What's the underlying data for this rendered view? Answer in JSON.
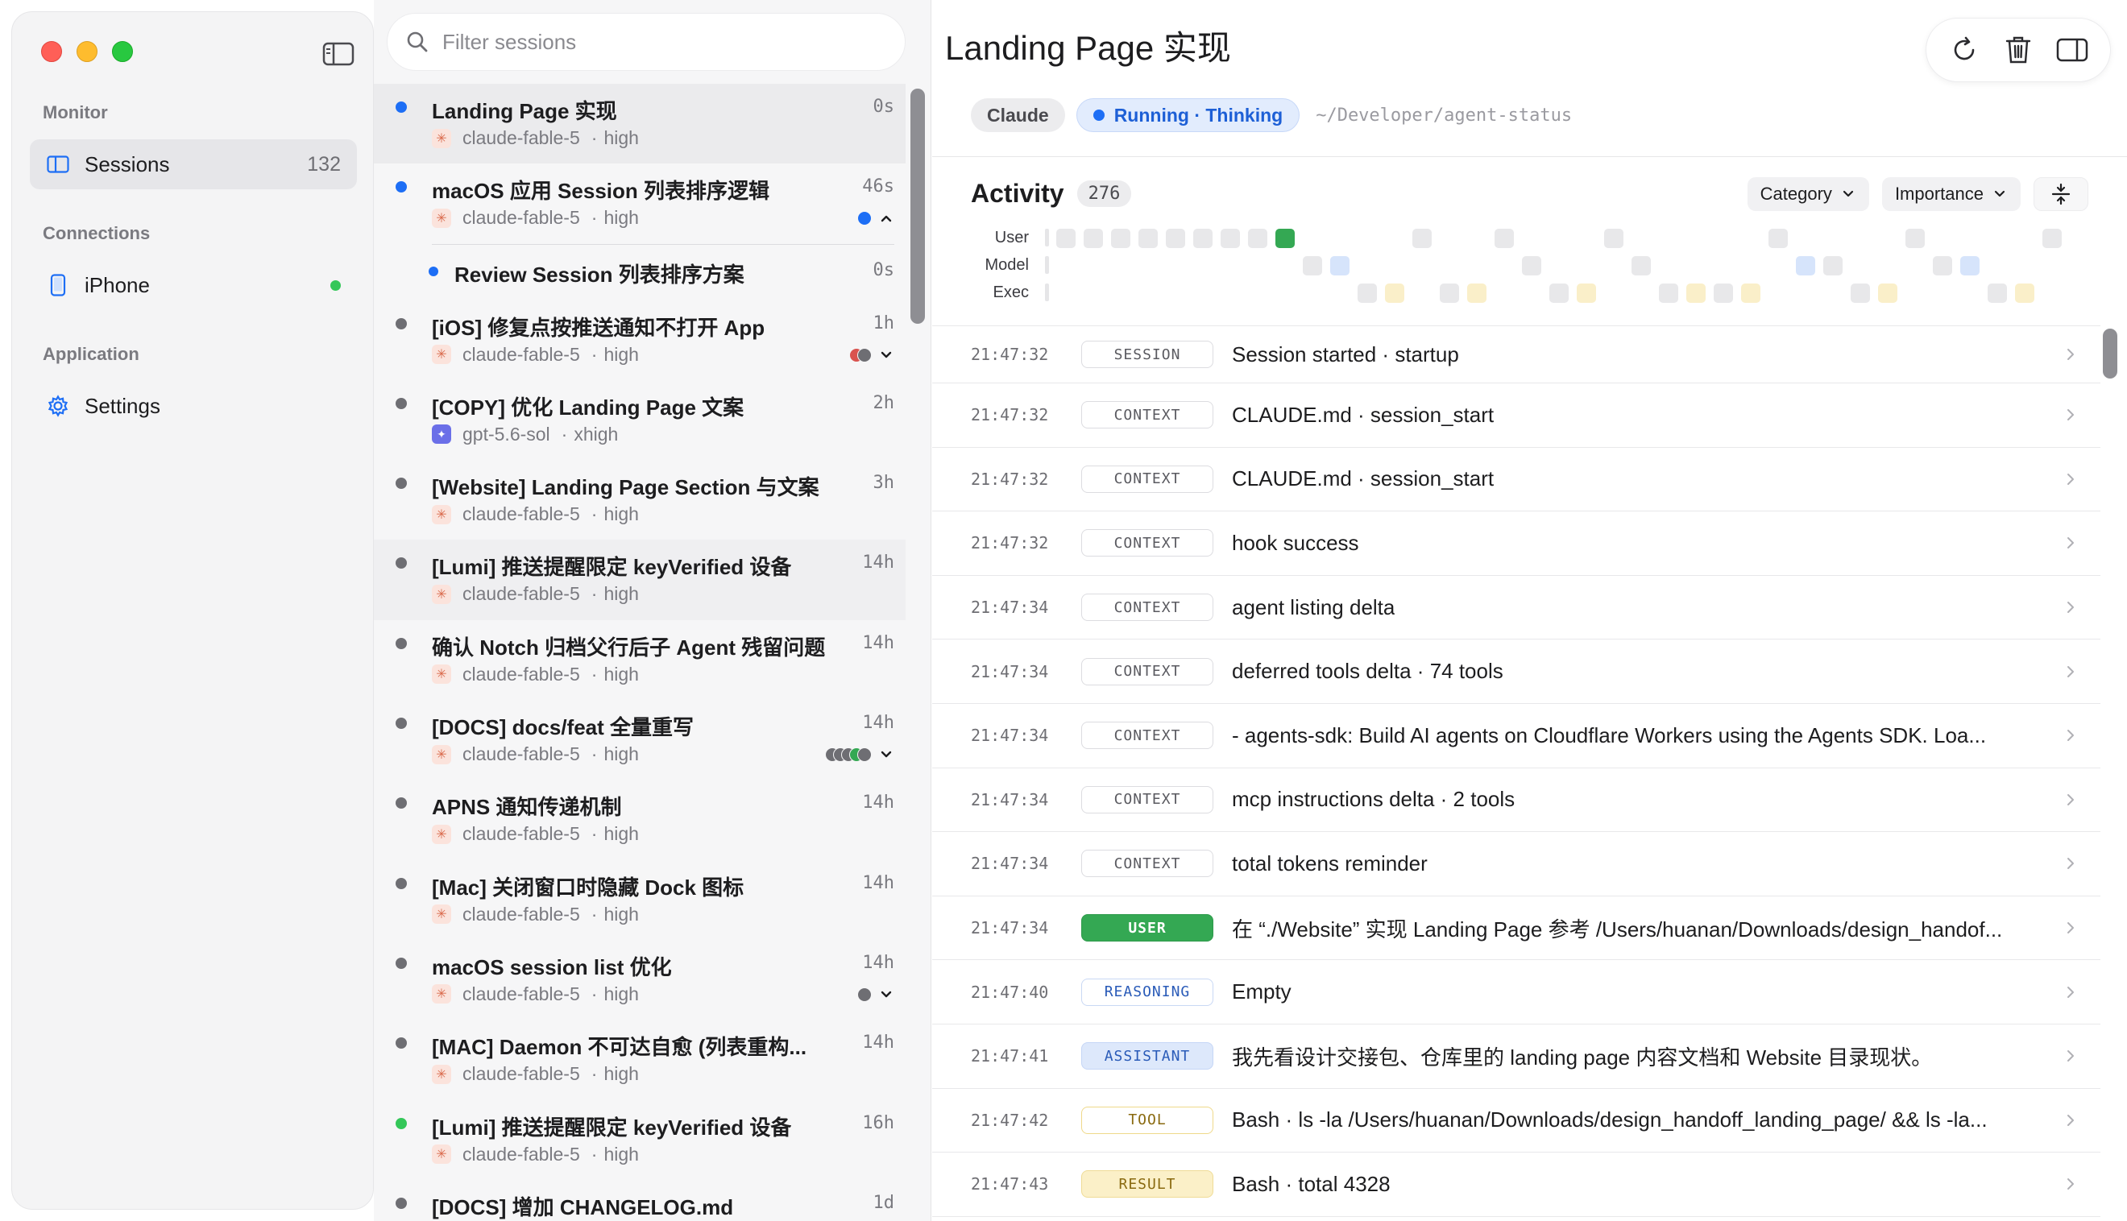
{
  "sidebar": {
    "sections": [
      {
        "label": "Monitor",
        "items": [
          {
            "label": "Sessions",
            "count": "132",
            "icon": "sidebar-panel-icon"
          }
        ]
      },
      {
        "label": "Connections",
        "items": [
          {
            "label": "iPhone",
            "icon": "phone-icon",
            "status": "online"
          }
        ]
      },
      {
        "label": "Application",
        "items": [
          {
            "label": "Settings",
            "icon": "gear-icon"
          }
        ]
      }
    ]
  },
  "search": {
    "placeholder": "Filter sessions"
  },
  "sessions": [
    {
      "title": "Landing Page 实现",
      "time": "0s",
      "model": "claude-fable-5",
      "effort": "high",
      "dot": "blue",
      "provider": "claude",
      "state": "selected"
    },
    {
      "title": "macOS 应用 Session 列表排序逻辑",
      "time": "46s",
      "model": "claude-fable-5",
      "effort": "high",
      "dot": "blue",
      "provider": "claude",
      "status_dots": [
        "#1d6ef5"
      ],
      "expanded": true,
      "children": [
        {
          "title": "Review Session 列表排序方案",
          "time": "0s"
        }
      ]
    },
    {
      "title": "[iOS] 修复点按推送通知不打开 App",
      "time": "1h",
      "model": "claude-fable-5",
      "effort": "high",
      "dot": "gray",
      "provider": "claude",
      "status_dots": [
        "#d9534f",
        "#6e6e73"
      ],
      "collapsed": true
    },
    {
      "title": "[COPY] 优化 Landing Page 文案",
      "time": "2h",
      "model": "gpt-5.6-sol",
      "effort": "xhigh",
      "dot": "gray",
      "provider": "gpt"
    },
    {
      "title": "[Website] Landing Page Section 与文案",
      "time": "3h",
      "model": "claude-fable-5",
      "effort": "high",
      "dot": "gray",
      "provider": "claude"
    },
    {
      "title": "[Lumi] 推送提醒限定 keyVerified 设备",
      "time": "14h",
      "model": "claude-fable-5",
      "effort": "high",
      "dot": "gray",
      "provider": "claude",
      "state": "hovered"
    },
    {
      "title": "确认 Notch 归档父行后子 Agent 残留问题",
      "time": "14h",
      "model": "claude-fable-5",
      "effort": "high",
      "dot": "gray",
      "provider": "claude"
    },
    {
      "title": "[DOCS] docs/feat 全量重写",
      "time": "14h",
      "model": "claude-fable-5",
      "effort": "high",
      "dot": "gray",
      "provider": "claude",
      "status_dots": [
        "#6e6e73",
        "#6e6e73",
        "#6e6e73",
        "#34a853",
        "#6e6e73"
      ],
      "collapsed": true
    },
    {
      "title": "APNS 通知传递机制",
      "time": "14h",
      "model": "claude-fable-5",
      "effort": "high",
      "dot": "gray",
      "provider": "claude"
    },
    {
      "title": "[Mac] 关闭窗口时隐藏 Dock 图标",
      "time": "14h",
      "model": "claude-fable-5",
      "effort": "high",
      "dot": "gray",
      "provider": "claude"
    },
    {
      "title": "macOS session list 优化",
      "time": "14h",
      "model": "claude-fable-5",
      "effort": "high",
      "dot": "gray",
      "provider": "claude",
      "status_dots": [
        "#6e6e73"
      ],
      "collapsed": true
    },
    {
      "title": "[MAC] Daemon 不可达自愈 (列表重构...",
      "time": "14h",
      "model": "claude-fable-5",
      "effort": "high",
      "dot": "gray",
      "provider": "claude"
    },
    {
      "title": "[Lumi] 推送提醒限定 keyVerified 设备",
      "time": "16h",
      "model": "claude-fable-5",
      "effort": "high",
      "dot": "green",
      "provider": "claude"
    },
    {
      "title": "[DOCS] 增加 CHANGELOG.md",
      "time": "1d",
      "model": "claude-fable-5",
      "effort": "high",
      "dot": "gray",
      "provider": "claude"
    }
  ],
  "detail": {
    "title": "Landing Page 实现",
    "toolbar": [
      "refresh-icon",
      "trash-icon",
      "inspector-panel-icon"
    ],
    "agent_tag": "Claude",
    "status_tag": "Running · Thinking",
    "path": "~/Developer/agent-status",
    "activity": {
      "label": "Activity",
      "count": "276",
      "filters": [
        "Category",
        "Importance"
      ],
      "lanes": [
        {
          "name": "User",
          "cells": [
            [
              0,
              "g"
            ],
            [
              1,
              "g"
            ],
            [
              2,
              "g"
            ],
            [
              3,
              "g"
            ],
            [
              4,
              "g"
            ],
            [
              5,
              "g"
            ],
            [
              6,
              "g"
            ],
            [
              7,
              "g"
            ],
            [
              8,
              "green"
            ],
            [
              13,
              "g"
            ],
            [
              16,
              "g"
            ],
            [
              20,
              "g"
            ],
            [
              26,
              "g"
            ],
            [
              31,
              "g"
            ],
            [
              36,
              "g"
            ]
          ]
        },
        {
          "name": "Model",
          "cells": [
            [
              9,
              "g"
            ],
            [
              10,
              "blue"
            ],
            [
              17,
              "g"
            ],
            [
              21,
              "g"
            ],
            [
              27,
              "blue"
            ],
            [
              28,
              "g"
            ],
            [
              32,
              "g"
            ],
            [
              33,
              "blue"
            ]
          ]
        },
        {
          "name": "Exec",
          "cells": [
            [
              11,
              "g"
            ],
            [
              12,
              "yellow"
            ],
            [
              14,
              "g"
            ],
            [
              15,
              "yellow"
            ],
            [
              18,
              "g"
            ],
            [
              19,
              "yellow"
            ],
            [
              22,
              "g"
            ],
            [
              23,
              "yellow"
            ],
            [
              24,
              "g"
            ],
            [
              25,
              "yellow"
            ],
            [
              29,
              "g"
            ],
            [
              30,
              "yellow"
            ],
            [
              34,
              "g"
            ],
            [
              35,
              "yellow"
            ]
          ]
        }
      ]
    },
    "events": [
      {
        "time": "21:47:32",
        "type": "SESSION",
        "kind": "session",
        "text": "Session started · startup"
      },
      {
        "time": "21:47:32",
        "type": "CONTEXT",
        "kind": "context",
        "text": "CLAUDE.md · session_start"
      },
      {
        "time": "21:47:32",
        "type": "CONTEXT",
        "kind": "context",
        "text": "CLAUDE.md · session_start"
      },
      {
        "time": "21:47:32",
        "type": "CONTEXT",
        "kind": "context",
        "text": "hook success"
      },
      {
        "time": "21:47:34",
        "type": "CONTEXT",
        "kind": "context",
        "text": "agent listing delta"
      },
      {
        "time": "21:47:34",
        "type": "CONTEXT",
        "kind": "context",
        "text": "deferred tools delta · 74 tools"
      },
      {
        "time": "21:47:34",
        "type": "CONTEXT",
        "kind": "context",
        "text": "- agents-sdk: Build AI agents on Cloudflare Workers using the Agents SDK. Loa..."
      },
      {
        "time": "21:47:34",
        "type": "CONTEXT",
        "kind": "context",
        "text": "mcp instructions delta · 2 tools"
      },
      {
        "time": "21:47:34",
        "type": "CONTEXT",
        "kind": "context",
        "text": "total tokens reminder"
      },
      {
        "time": "21:47:34",
        "type": "USER",
        "kind": "user",
        "text": "在 “./Website” 实现 Landing Page 参考 /Users/huanan/Downloads/design_handof..."
      },
      {
        "time": "21:47:40",
        "type": "REASONING",
        "kind": "reasoning",
        "text": "Empty"
      },
      {
        "time": "21:47:41",
        "type": "ASSISTANT",
        "kind": "assistant",
        "text": "我先看设计交接包、仓库里的 landing page 内容文档和 Website 目录现状。"
      },
      {
        "time": "21:47:42",
        "type": "TOOL",
        "kind": "tool",
        "text": "Bash · ls -la /Users/huanan/Downloads/design_handoff_landing_page/ && ls -la..."
      },
      {
        "time": "21:47:43",
        "type": "RESULT",
        "kind": "result",
        "text": "Bash · total 4328"
      }
    ]
  },
  "colors": {
    "accent": "#1d6ef5",
    "user_green": "#34a853"
  }
}
